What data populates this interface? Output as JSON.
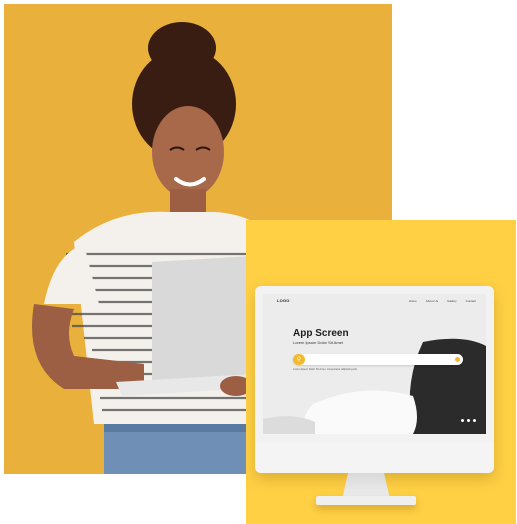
{
  "photo": {
    "background": "#e9b13b"
  },
  "panel": {
    "background": "#ffd044"
  },
  "monitor": {
    "logo": "LOGO",
    "nav_items": [
      "Home",
      "About Us",
      "Gallery",
      "Contact"
    ],
    "hero": {
      "title": "App Screen",
      "subtitle": "Lorem Ipsum Dolor Sit Amet",
      "caption": "Lorem Ipsum Dolor Sit Amet, consectetur adipiscing elit"
    },
    "search": {
      "placeholder": "",
      "icon": "search-icon",
      "accent": "#f5b92e"
    }
  }
}
